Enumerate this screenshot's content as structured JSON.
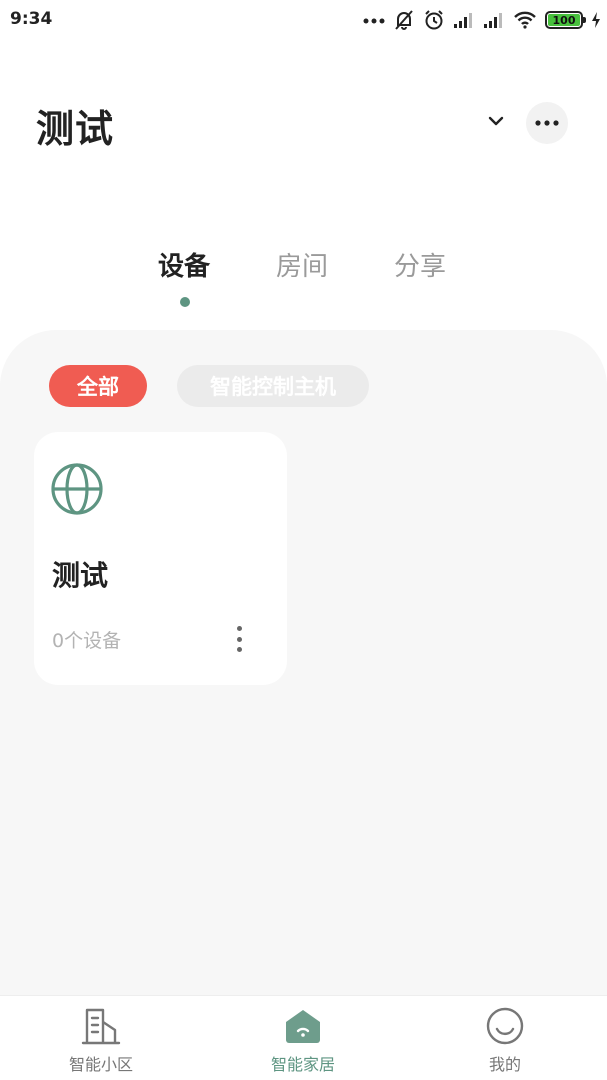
{
  "status_bar": {
    "time": "9:34",
    "battery_level": "100",
    "icons": [
      "more-dots-icon",
      "mute-bell-icon",
      "alarm-icon",
      "signal-icon",
      "signal-icon",
      "wifi-icon",
      "battery-icon",
      "charging-icon"
    ]
  },
  "header": {
    "title": "测试",
    "icons": [
      "chevron-down-icon",
      "more-icon"
    ]
  },
  "tabs": [
    {
      "label": "设备",
      "active": true
    },
    {
      "label": "房间",
      "active": false
    },
    {
      "label": "分享",
      "active": false
    }
  ],
  "filters": [
    {
      "label": "全部",
      "active": true
    },
    {
      "label": "智能控制主机",
      "active": false
    }
  ],
  "cards": [
    {
      "title": "测试",
      "subtitle": "0个设备",
      "icon": "globe-icon"
    }
  ],
  "bottom_nav": [
    {
      "label": "智能小区",
      "icon": "building-icon",
      "active": false
    },
    {
      "label": "智能家居",
      "icon": "home-icon",
      "active": true
    },
    {
      "label": "我的",
      "icon": "smile-face-icon",
      "active": false
    }
  ],
  "colors": {
    "accent": "#5e9582",
    "chip_active": "#f05c52",
    "chip_inactive": "#ebebeb",
    "panel_bg": "#f7f7f7"
  }
}
